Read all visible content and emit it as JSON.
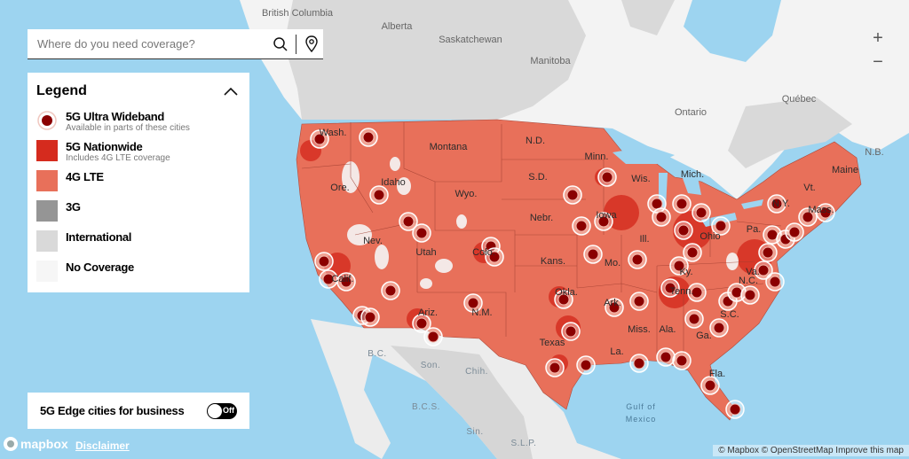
{
  "search": {
    "placeholder": "Where do you need coverage?",
    "search_icon": "magnifier",
    "location_icon": "map-pin"
  },
  "legend": {
    "title": "Legend",
    "collapse_icon": "chevron-up",
    "items": [
      {
        "label": "5G Ultra Wideband",
        "sub": "Available in parts of these cities",
        "color": "#8b0000",
        "kind": "marker"
      },
      {
        "label": "5G Nationwide",
        "sub": "Includes 4G LTE coverage",
        "color": "#d52b1e",
        "kind": "square"
      },
      {
        "label": "4G LTE",
        "sub": "",
        "color": "#e8705a",
        "kind": "square"
      },
      {
        "label": "3G",
        "sub": "",
        "color": "#959595",
        "kind": "square"
      },
      {
        "label": "International",
        "sub": "",
        "color": "#d9d9d9",
        "kind": "square"
      },
      {
        "label": "No Coverage",
        "sub": "",
        "color": "#f6f6f6",
        "kind": "square"
      }
    ]
  },
  "edge_toggle": {
    "label": "5G Edge cities for business",
    "state": "Off"
  },
  "zoom": {
    "in": "+",
    "out": "−"
  },
  "footer": {
    "logo": "mapbox",
    "disclaimer": "Disclaimer",
    "attribution_mapbox": "© Mapbox",
    "attribution_osm": "© OpenStreetMap",
    "improve": "Improve this map"
  },
  "colors": {
    "water": "#9dd4f0",
    "lte": "#e8705a",
    "nationwide": "#d52b1e",
    "international": "#d9d9d9",
    "no_coverage": "#f6f6f6",
    "uwb": "#8b0000"
  },
  "map_labels": {
    "canada": [
      "British Columbia",
      "Alberta",
      "Saskatchewan",
      "Manitoba",
      "Ontario",
      "Québec",
      "N.B."
    ],
    "us": [
      "Wash.",
      "Ore.",
      "Idaho",
      "Montana",
      "Wyo.",
      "N.D.",
      "S.D.",
      "Nebr.",
      "Minn.",
      "Wis.",
      "Iowa",
      "Mich.",
      "Ill.",
      "Ohio",
      "Pa.",
      "N.Y.",
      "Vt.",
      "Maine",
      "Mass.",
      "Nev.",
      "Utah",
      "Colo.",
      "Kans.",
      "Mo.",
      "Ky.",
      "Va.",
      "Calif.",
      "Ariz.",
      "N.M.",
      "Okla.",
      "Ark.",
      "Tenn.",
      "N.C.",
      "Miss.",
      "Ala.",
      "Ga.",
      "S.C.",
      "Texas",
      "La.",
      "Fla."
    ],
    "mexico": [
      "B.C.",
      "Son.",
      "Chih.",
      "B.C.S.",
      "Sin.",
      "S.L.P."
    ],
    "water": [
      "Gulf of",
      "Mexico"
    ]
  }
}
